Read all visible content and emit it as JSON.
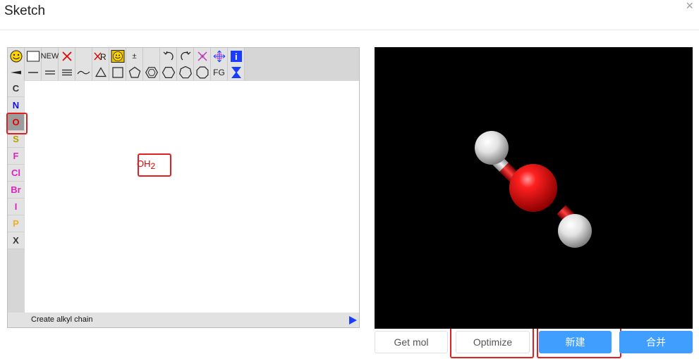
{
  "dialog": {
    "title": "Sketch",
    "close_glyph": "×"
  },
  "toolbar": {
    "row1": [
      {
        "name": "smiley-icon",
        "kind": "smiley"
      },
      {
        "name": "rectangle-select-icon",
        "kind": "rect"
      },
      {
        "name": "new-button",
        "kind": "text",
        "text": "NEW"
      },
      {
        "name": "delete-icon",
        "kind": "x-red"
      },
      {
        "name": "blank-slot",
        "kind": "blank"
      },
      {
        "name": "remove-r-group-icon",
        "kind": "xr",
        "text": "R"
      },
      {
        "name": "smiley-selected-icon",
        "kind": "smiley-sq"
      },
      {
        "name": "charge-icon",
        "kind": "text",
        "text": "±"
      },
      {
        "name": "blank-slot-2",
        "kind": "blank"
      },
      {
        "name": "undo-icon",
        "kind": "undo"
      },
      {
        "name": "redo-icon",
        "kind": "redo"
      },
      {
        "name": "clear-icon",
        "kind": "x-mag"
      },
      {
        "name": "move-icon",
        "kind": "move"
      },
      {
        "name": "info-icon",
        "kind": "info",
        "text": "i"
      }
    ],
    "row2": [
      {
        "name": "wedge-bond-icon",
        "kind": "wedge"
      },
      {
        "name": "single-bond-icon",
        "kind": "single"
      },
      {
        "name": "double-bond-icon",
        "kind": "double"
      },
      {
        "name": "triple-bond-icon",
        "kind": "triple"
      },
      {
        "name": "chain-icon",
        "kind": "wave"
      },
      {
        "name": "triangle-ring-icon",
        "kind": "poly3"
      },
      {
        "name": "square-ring-icon",
        "kind": "poly4"
      },
      {
        "name": "pentagon-ring-icon",
        "kind": "poly5"
      },
      {
        "name": "benzene-ring-icon",
        "kind": "benzene"
      },
      {
        "name": "hexagon-ring-icon",
        "kind": "poly6"
      },
      {
        "name": "heptagon-ring-icon",
        "kind": "poly7"
      },
      {
        "name": "octagon-ring-icon",
        "kind": "poly8"
      },
      {
        "name": "functional-group-button",
        "kind": "text",
        "text": "FG"
      },
      {
        "name": "template-icon",
        "kind": "template"
      }
    ]
  },
  "atoms": [
    {
      "symbol": "C",
      "color": "#333333",
      "selected": false
    },
    {
      "symbol": "N",
      "color": "#1010e0",
      "selected": false
    },
    {
      "symbol": "O",
      "color": "#e00000",
      "selected": true
    },
    {
      "symbol": "S",
      "color": "#b5a200",
      "selected": false
    },
    {
      "symbol": "F",
      "color": "#e020c0",
      "selected": false
    },
    {
      "symbol": "Cl",
      "color": "#e020c0",
      "selected": false
    },
    {
      "symbol": "Br",
      "color": "#e020c0",
      "selected": false
    },
    {
      "symbol": "I",
      "color": "#e020c0",
      "selected": false
    },
    {
      "symbol": "P",
      "color": "#f0b020",
      "selected": false
    },
    {
      "symbol": "X",
      "color": "#333333",
      "selected": false
    }
  ],
  "molecule": {
    "main": "OH",
    "subscript": "2"
  },
  "statusbar": {
    "text": "Create alkyl chain"
  },
  "buttons": {
    "get_mol": "Get mol",
    "optimize": "Optimize",
    "new": "新建",
    "merge": "合并"
  },
  "colors": {
    "primary": "#409eff",
    "highlight": "#e02020",
    "oxygen": "#e00000"
  }
}
